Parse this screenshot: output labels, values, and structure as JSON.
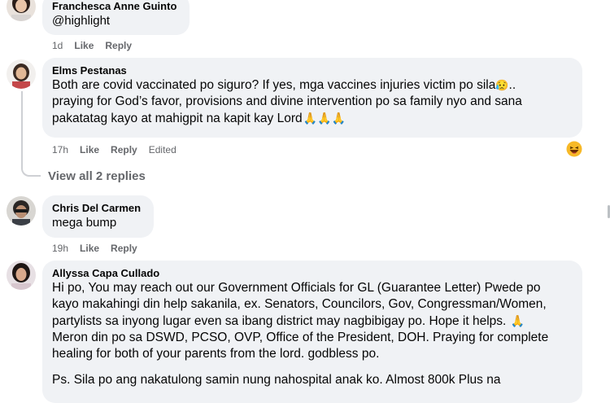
{
  "comments": [
    {
      "author": "Franchesca Anne Guinto",
      "text": "@highlight",
      "time": "1d",
      "like": "Like",
      "reply": "Reply"
    },
    {
      "author": "Elms Pestanas",
      "lines": [
        "Both are covid vaccinated po siguro? If yes, mga vaccines injuries victim po sila",
        "praying for God’s favor, provisions and divine intervention po sa family nyo and sana",
        "pakatatag kayo at mahigpit na kapit kay Lord"
      ],
      "sad_emoji": "😥",
      "ellipsis": "..",
      "pray_emojis": "🙏🙏🙏",
      "time": "17h",
      "like": "Like",
      "reply": "Reply",
      "edited": "Edited",
      "reaction_emoji": "😆",
      "view_replies": "View all 2 replies"
    },
    {
      "author": "Chris Del Carmen",
      "text": "mega bump",
      "time": "19h",
      "like": "Like",
      "reply": "Reply"
    },
    {
      "author": "Allyssa Capa Cullado",
      "lines": [
        "Hi po, You may reach out our Government Officials for GL (Guarantee Letter) Pwede po",
        "kayo makahingi din help sakanila, ex. Senators, Councilors, Gov, Congressman/Women,",
        "partylists sa inyong lugar even sa ibang district may nagbibigay po. Hope it helps.",
        "Meron din po sa DSWD, PCSO, OVP, Office of the President, DOH. Praying for complete",
        "healing for both of your parents from the lord. godbless po.",
        "Ps. Sila po ang nakatulong samin nung nahospital anak ko. Almost 800k Plus na"
      ],
      "pray_emoji": "🙏"
    }
  ],
  "colors": {
    "bubble": "#f0f2f5",
    "meta_text": "#65676b",
    "thread_line": "#ced0d4"
  }
}
